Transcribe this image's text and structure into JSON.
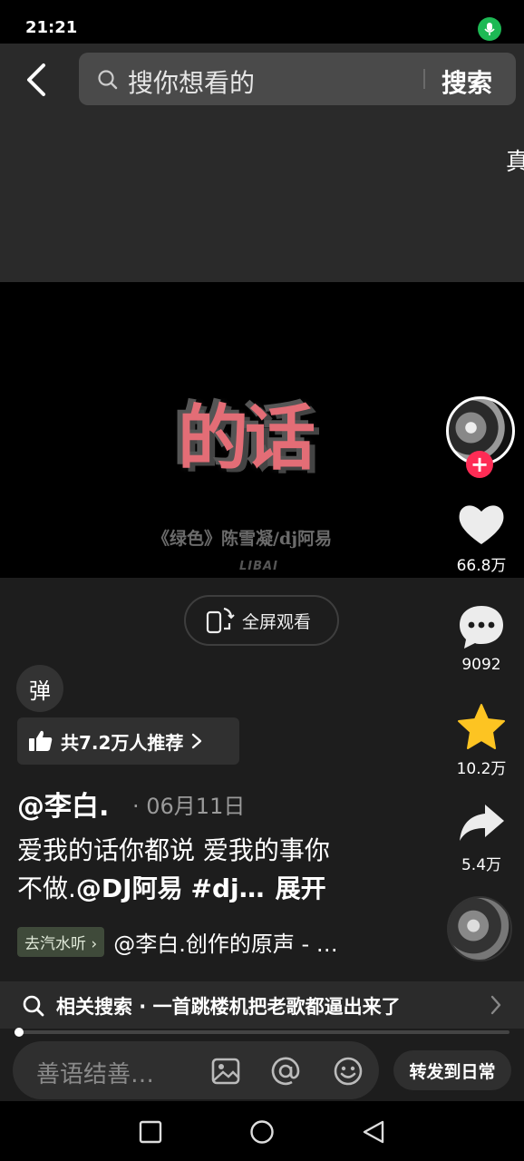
{
  "status_bar": {
    "time": "21:21"
  },
  "search": {
    "placeholder": "搜你想看的",
    "button_label": "搜索"
  },
  "edge_text": "真",
  "video": {
    "title_text": "的话",
    "subtitle": "《绿色》陈雪凝/dj阿易",
    "watermark": "LIBAI"
  },
  "fullscreen": {
    "label": "全屏观看"
  },
  "danmu": {
    "label": "弹"
  },
  "recommend": {
    "label": "共7.2万人推荐"
  },
  "post": {
    "author": "@李白.",
    "date": "· 06月11日",
    "caption_line1": "爱我的话你都说 爱我的事你",
    "caption_line2_text": "不做.",
    "caption_mention": "@DJ阿易",
    "caption_hashtag": "#dj…",
    "expand_label": "展开"
  },
  "music": {
    "tag": "去汽水听 ›",
    "text": "@李白.创作的原声 - …"
  },
  "actions": {
    "likes": "66.8万",
    "comments": "9092",
    "favorites": "10.2万",
    "shares": "5.4万"
  },
  "related": {
    "text": "相关搜索 · 一首跳楼机把老歌都逼出来了"
  },
  "progress": {
    "fraction": 0.01
  },
  "comment": {
    "placeholder": "善语结善…",
    "share_label": "转发到日常"
  },
  "colors": {
    "accent": "#fe2c55",
    "favorite": "#fdc422",
    "mic": "#1db954"
  }
}
